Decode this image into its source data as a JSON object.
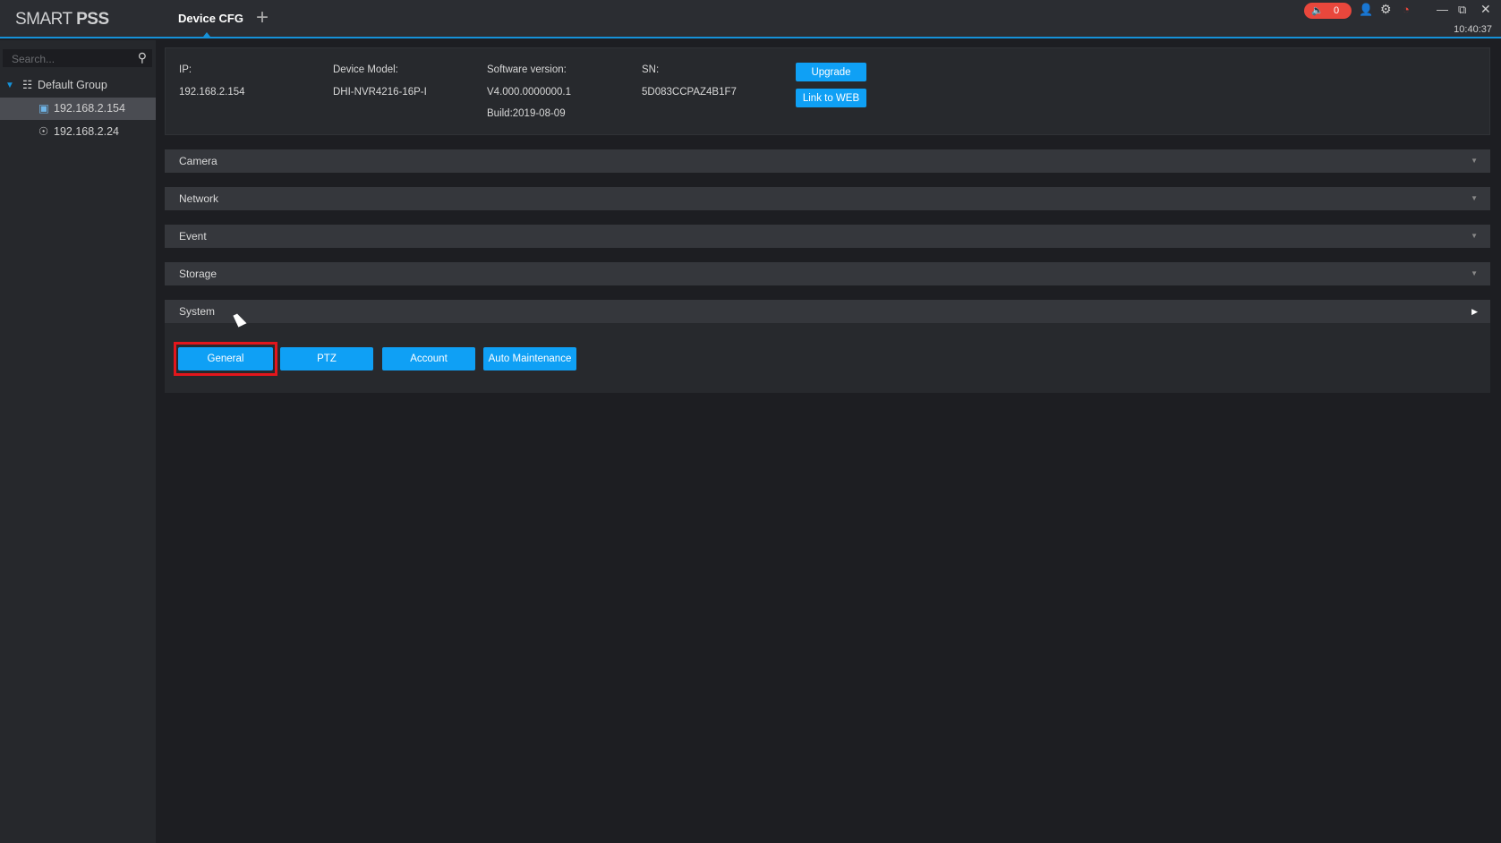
{
  "app": {
    "logo_light": "SMART ",
    "logo_bold": "PSS",
    "tab": "Device CFG",
    "add_tab": "+",
    "alarm_count": "0",
    "clock": "10:40:37"
  },
  "sidebar": {
    "search_placeholder": "Search...",
    "group": "Default Group",
    "devices": [
      "192.168.2.154",
      "192.168.2.24"
    ]
  },
  "info": {
    "ip_label": "IP:",
    "ip": "192.168.2.154",
    "model_label": "Device Model:",
    "model": "DHI-NVR4216-16P-I",
    "sw_label": "Software version:",
    "sw": "V4.000.0000000.1",
    "build": "Build:2019-08-09",
    "sn_label": "SN:",
    "sn": "5D083CCPAZ4B1F7",
    "upgrade": "Upgrade",
    "link_web": "Link to WEB"
  },
  "sections": [
    "Camera",
    "Network",
    "Event",
    "Storage",
    "System"
  ],
  "system_buttons": [
    "General",
    "PTZ",
    "Account",
    "Auto Maintenance"
  ],
  "colors": {
    "accent": "#0fa0f5",
    "alarm": "#e9473c",
    "highlight": "#e3161c"
  }
}
